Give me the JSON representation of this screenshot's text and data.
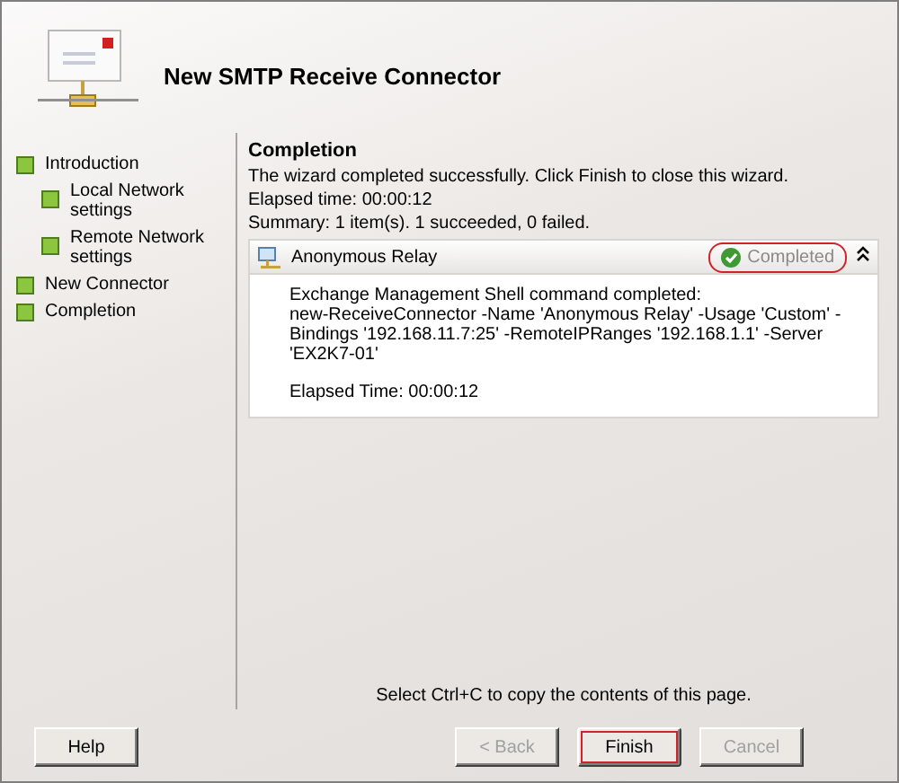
{
  "window": {
    "title": "New SMTP Receive Connector"
  },
  "steps": [
    {
      "label": "Introduction",
      "children": [
        {
          "label": "Local Network settings"
        },
        {
          "label": "Remote Network settings"
        }
      ]
    },
    {
      "label": "New Connector"
    },
    {
      "label": "Completion"
    }
  ],
  "page": {
    "heading": "Completion",
    "lines": [
      "The wizard completed successfully. Click Finish to close this wizard.",
      "Elapsed time: 00:00:12",
      "Summary: 1 item(s). 1 succeeded, 0 failed."
    ],
    "result": {
      "name": "Anonymous Relay",
      "status": "Completed",
      "highlighted": true,
      "expanded": true,
      "details": [
        "Exchange Management Shell command completed:",
        "new-ReceiveConnector -Name 'Anonymous Relay' -Usage 'Custom' -Bindings '192.168.11.7:25' -RemoteIPRanges '192.168.1.1' -Server 'EX2K7-01'",
        "Elapsed Time: 00:00:12"
      ]
    },
    "footer": "Select Ctrl+C to copy the contents of this page."
  },
  "buttons": [
    {
      "kind": "help",
      "label": "Help",
      "disabled": false,
      "highlighted": false
    },
    {
      "kind": "nav",
      "label": "< Back",
      "disabled": true,
      "highlighted": false
    },
    {
      "kind": "nav",
      "label": "Finish",
      "disabled": false,
      "highlighted": true
    },
    {
      "kind": "nav",
      "label": "Cancel",
      "disabled": true,
      "highlighted": false
    }
  ]
}
